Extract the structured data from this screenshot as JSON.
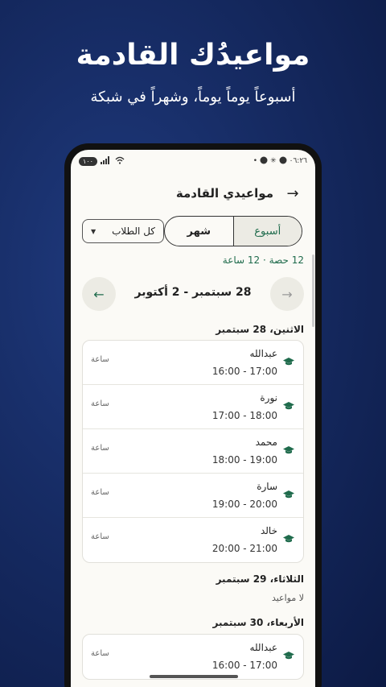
{
  "hero": {
    "title": "مواعيدُك القادمة",
    "subtitle": "أسبوعاً يوماً يوماً، وشهراً في شبكة"
  },
  "status_bar": {
    "time": "٠٦:٢٦",
    "battery": "١٠٠"
  },
  "app_bar": {
    "title": "مواعيدي القادمة"
  },
  "view_toggle": {
    "week_label": "أسبوع",
    "month_label": "شهر",
    "selected": "week"
  },
  "filter": {
    "selected": "كل الطلاب"
  },
  "summary": "12 حصة · 12 ساعة",
  "week_nav": {
    "range": "28 سبتمبر - 2 أكتوبر"
  },
  "days": [
    {
      "header": "الاثنين، 28 سبتمبر",
      "appointments": [
        {
          "name": "عبدالله",
          "time": "16:00 - 17:00",
          "duration": "ساعة"
        },
        {
          "name": "نورة",
          "time": "17:00 - 18:00",
          "duration": "ساعة"
        },
        {
          "name": "محمد",
          "time": "18:00 - 19:00",
          "duration": "ساعة"
        },
        {
          "name": "سارة",
          "time": "19:00 - 20:00",
          "duration": "ساعة"
        },
        {
          "name": "خالد",
          "time": "20:00 - 21:00",
          "duration": "ساعة"
        }
      ]
    },
    {
      "header": "الثلاثاء، 29 سبتمبر",
      "empty_label": "لا مواعيد"
    },
    {
      "header": "الأربعاء، 30 سبتمبر",
      "appointments": [
        {
          "name": "عبدالله",
          "time": "16:00 - 17:00",
          "duration": "ساعة"
        }
      ]
    }
  ],
  "colors": {
    "accent": "#1f6b4c",
    "background": "#162b63",
    "screen": "#fbfaf6"
  }
}
